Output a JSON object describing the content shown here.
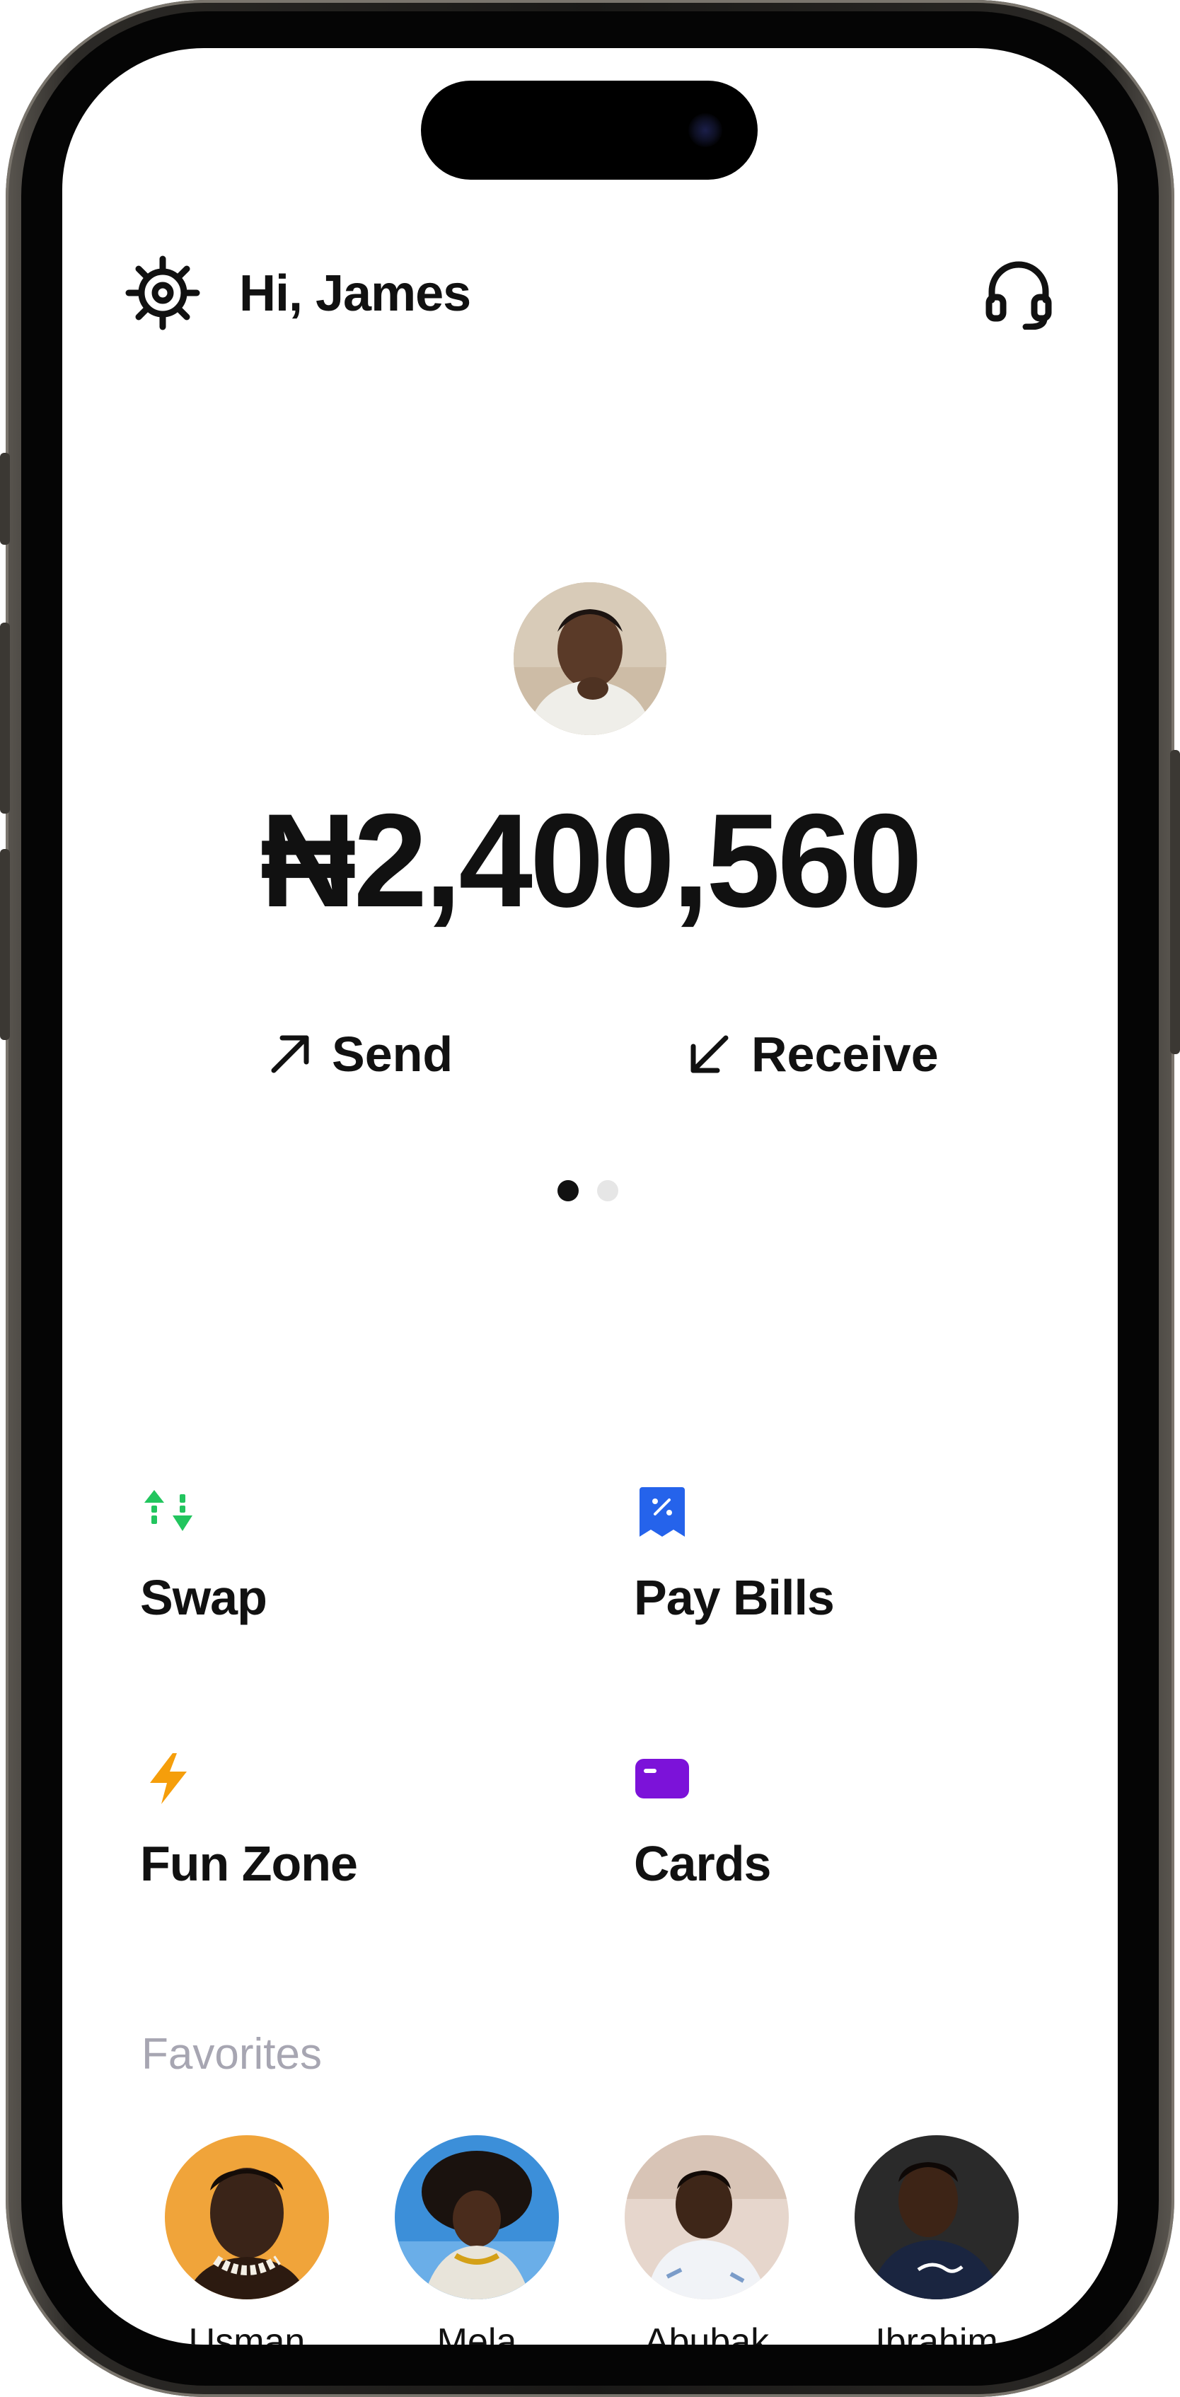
{
  "header": {
    "greeting": "Hi, James",
    "settings_icon": "gear-icon",
    "support_icon": "headset-icon"
  },
  "wallet": {
    "balance": "₦2,400,560",
    "send_label": "Send",
    "receive_label": "Receive",
    "page_indicator": {
      "pages": 2,
      "active": 1
    }
  },
  "services": [
    {
      "label": "Swap",
      "icon": "swap-arrows-icon",
      "color": "#22c55e"
    },
    {
      "label": "Pay Bills",
      "icon": "receipt-percent-icon",
      "color": "#2563eb"
    },
    {
      "label": "Fun Zone",
      "icon": "lightning-icon",
      "color": "#f59e0b"
    },
    {
      "label": "Cards",
      "icon": "card-icon",
      "color": "#7c12d9"
    }
  ],
  "favorites": {
    "title": "Favorites",
    "people": [
      {
        "name": "Usman"
      },
      {
        "name": "Mela"
      },
      {
        "name": "Abubak"
      },
      {
        "name": "Ibrahim"
      }
    ]
  }
}
